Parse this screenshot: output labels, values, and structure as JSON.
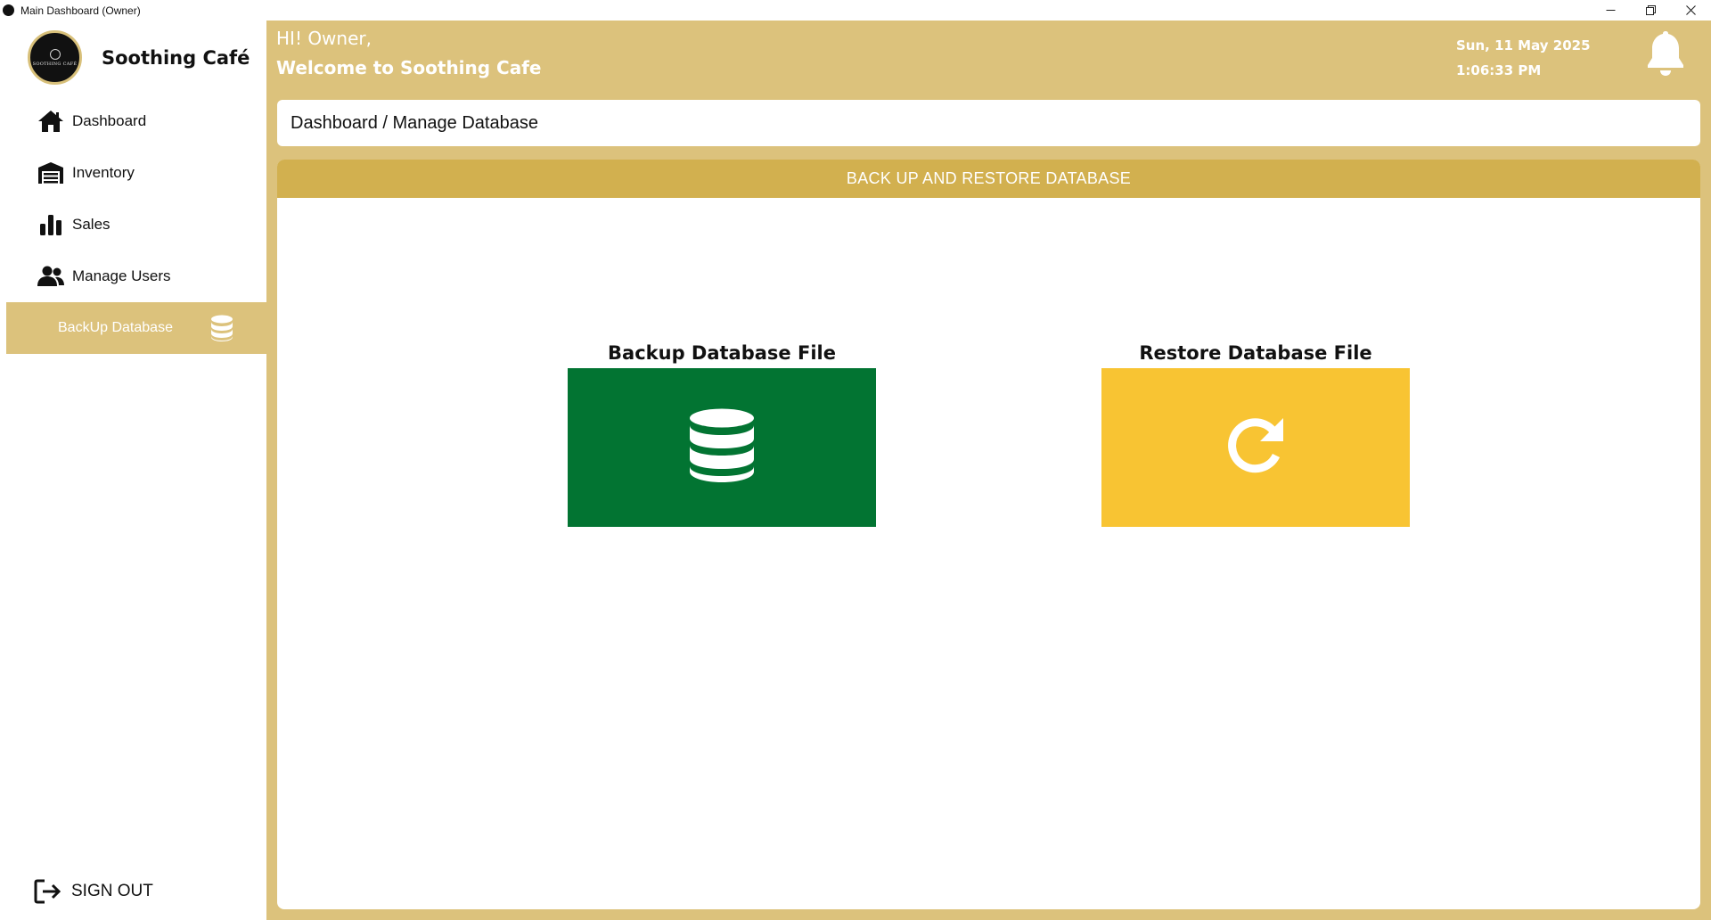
{
  "window": {
    "title": "Main Dashboard (Owner)",
    "controls": [
      "minimize",
      "restore",
      "close"
    ]
  },
  "sidebar": {
    "brand_name": "Soothing Café",
    "logo_text": "SOOTHING CAFÉ",
    "items": [
      {
        "label": "Dashboard",
        "icon": "home-icon"
      },
      {
        "label": "Inventory",
        "icon": "warehouse-icon"
      },
      {
        "label": "Sales",
        "icon": "bar-chart-icon"
      },
      {
        "label": "Manage Users",
        "icon": "users-icon"
      },
      {
        "label": "BackUp Database",
        "icon": "database-icon",
        "active": true
      }
    ],
    "signout_label": "SIGN OUT"
  },
  "header": {
    "greeting": "HI! Owner,",
    "welcome": "Welcome to Soothing Cafe",
    "date": "Sun, 11 May 2025",
    "time": "1:06:33 PM"
  },
  "breadcrumb": "Dashboard / Manage Database",
  "panel": {
    "title": "BACK UP AND RESTORE DATABASE",
    "backup_title": "Backup Database File",
    "restore_title": "Restore Database File"
  },
  "colors": {
    "accent": "#dcc27c",
    "panel_header": "#d2b04f",
    "backup": "#027432",
    "restore": "#f8c433"
  }
}
